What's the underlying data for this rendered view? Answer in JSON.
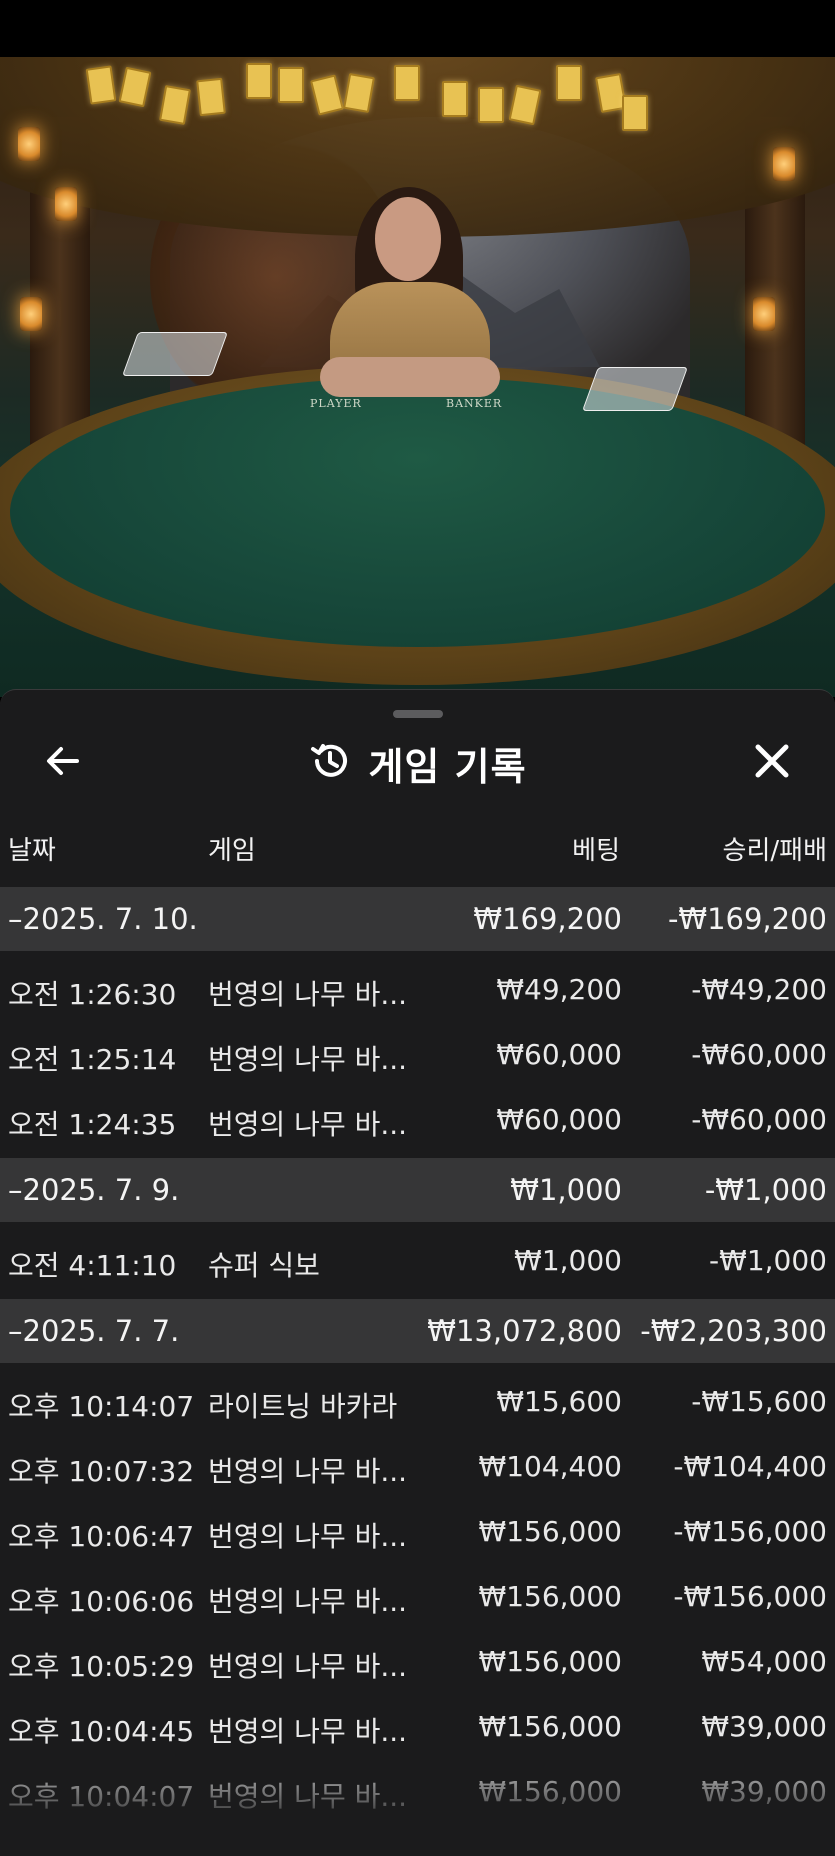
{
  "colors": {
    "sheet_bg": "#1b1b1c",
    "group_row_bg": "#363637",
    "text": "#ffffff",
    "table_felt": "#17483a"
  },
  "video": {
    "felt_labels": [
      "PLAYER",
      "BANKER"
    ]
  },
  "sheet": {
    "title": "게임 기록",
    "title_icon": "history-icon",
    "back_icon": "arrow-left-icon",
    "close_icon": "close-icon"
  },
  "columns": {
    "date": "날짜",
    "game": "게임",
    "bet": "베팅",
    "result": "승리/패배"
  },
  "groups": [
    {
      "date": "–2025. 7. 10.",
      "bet": "₩169,200",
      "result": "-₩169,200",
      "rows": [
        {
          "time": "오전 1:26:30",
          "game": "번영의 나무 바...",
          "bet": "₩49,200",
          "result": "-₩49,200"
        },
        {
          "time": "오전 1:25:14",
          "game": "번영의 나무 바...",
          "bet": "₩60,000",
          "result": "-₩60,000"
        },
        {
          "time": "오전 1:24:35",
          "game": "번영의 나무 바...",
          "bet": "₩60,000",
          "result": "-₩60,000"
        }
      ]
    },
    {
      "date": "–2025. 7. 9.",
      "bet": "₩1,000",
      "result": "-₩1,000",
      "rows": [
        {
          "time": "오전 4:11:10",
          "game": "슈퍼 식보",
          "bet": "₩1,000",
          "result": "-₩1,000"
        }
      ]
    },
    {
      "date": "–2025. 7. 7.",
      "bet": "₩13,072,800",
      "result": "-₩2,203,300",
      "rows": [
        {
          "time": "오후 10:14:07",
          "game": "라이트닝 바카라",
          "bet": "₩15,600",
          "result": "-₩15,600"
        },
        {
          "time": "오후 10:07:32",
          "game": "번영의 나무 바...",
          "bet": "₩104,400",
          "result": "-₩104,400"
        },
        {
          "time": "오후 10:06:47",
          "game": "번영의 나무 바...",
          "bet": "₩156,000",
          "result": "-₩156,000"
        },
        {
          "time": "오후 10:06:06",
          "game": "번영의 나무 바...",
          "bet": "₩156,000",
          "result": "-₩156,000"
        },
        {
          "time": "오후 10:05:29",
          "game": "번영의 나무 바...",
          "bet": "₩156,000",
          "result": "₩54,000"
        },
        {
          "time": "오후 10:04:45",
          "game": "번영의 나무 바...",
          "bet": "₩156,000",
          "result": "₩39,000"
        },
        {
          "time": "오후 10:04:07",
          "game": "번영의 나무 바...",
          "bet": "₩156,000",
          "result": "₩39,000"
        }
      ]
    }
  ]
}
